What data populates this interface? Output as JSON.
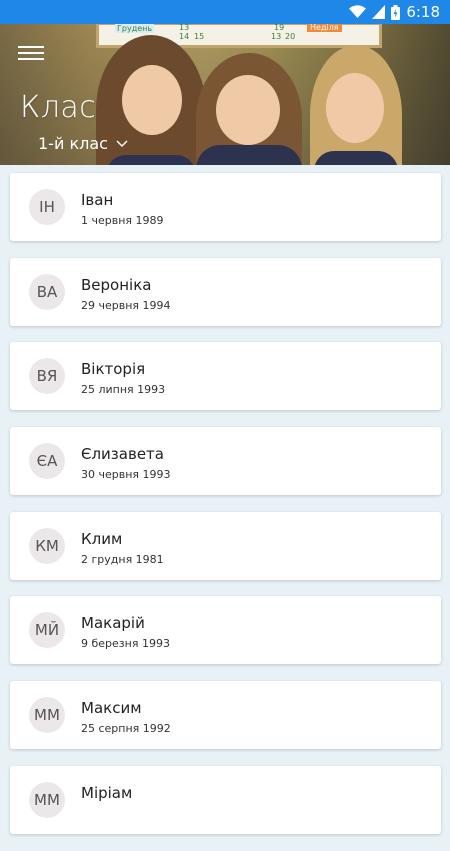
{
  "status_bar": {
    "time": "6:18"
  },
  "header": {
    "title": "Клас",
    "class_selector": "1-й клас",
    "board": {
      "month": "Грудень",
      "n1": "13",
      "n2": "14",
      "n3": "15",
      "n4": "19",
      "n5": "13",
      "n6": "20",
      "n7": "19",
      "n8": "20",
      "n9": "Неділя"
    }
  },
  "students": [
    {
      "initials": "ІН",
      "name": " Іван",
      "date": "1 червня 1989"
    },
    {
      "initials": "ВА",
      "name": "Вероніка",
      "date": "29 червня 1994"
    },
    {
      "initials": "ВЯ",
      "name": "Вікторія",
      "date": "25 липня 1993"
    },
    {
      "initials": "ЄА",
      "name": "Єлизавета",
      "date": "30 червня 1993"
    },
    {
      "initials": "КМ",
      "name": "Клим",
      "date": "2 грудня 1981"
    },
    {
      "initials": "МЙ",
      "name": "Макарій",
      "date": "9 березня 1993"
    },
    {
      "initials": "ММ",
      "name": "Максим",
      "date": "25 серпня 1992"
    },
    {
      "initials": "ММ",
      "name": "Міріам",
      "date": ""
    }
  ]
}
